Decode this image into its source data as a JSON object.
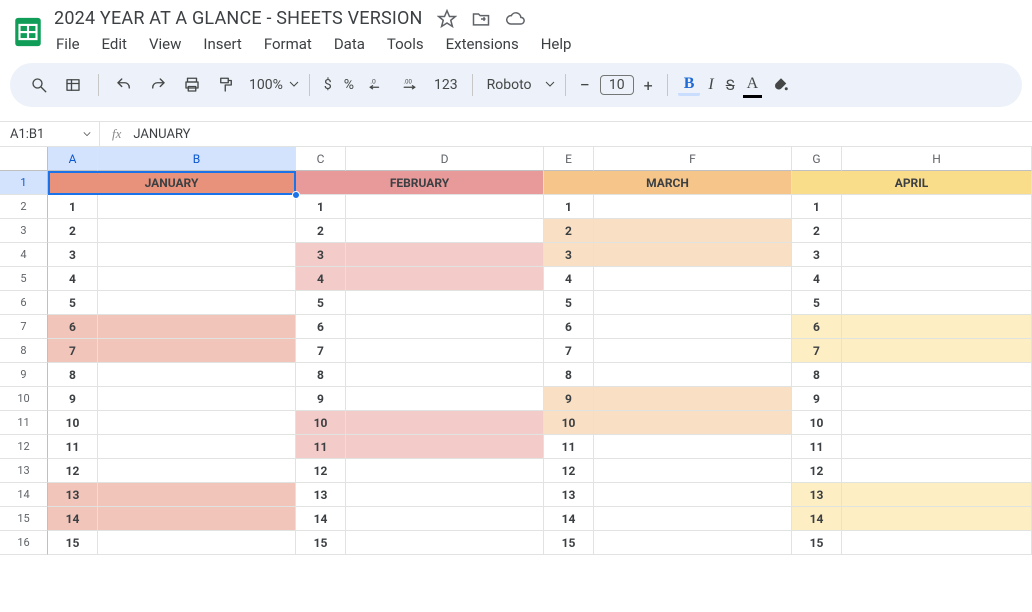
{
  "doc": {
    "title": "2024 YEAR AT A GLANCE - SHEETS VERSION",
    "menus": [
      "File",
      "Edit",
      "View",
      "Insert",
      "Format",
      "Data",
      "Tools",
      "Extensions",
      "Help"
    ]
  },
  "toolbar": {
    "zoom": "100%",
    "currency": "$",
    "percent": "%",
    "dec_less": ".0",
    "dec_more": ".00",
    "numformat": "123",
    "font": "Roboto",
    "minus": "−",
    "fontsize": "10",
    "plus": "+",
    "bold": "B",
    "italic": "I",
    "strike": "S",
    "textcolor": "A"
  },
  "namebox": "A1:B1",
  "formula": "JANUARY",
  "columns": [
    "A",
    "B",
    "C",
    "D",
    "E",
    "F",
    "G",
    "H"
  ],
  "col_selected": [
    "A",
    "B"
  ],
  "rows_visible": 16,
  "row_selected": 1,
  "months": [
    {
      "label": "JANUARY",
      "bg": "#e8927c"
    },
    {
      "label": "FEBRUARY",
      "bg": "#e89a9a"
    },
    {
      "label": "MARCH",
      "bg": "#f5c58a"
    },
    {
      "label": "APRIL",
      "bg": "#fadd8b"
    }
  ],
  "shade": {
    "jan": "#f1c5b9",
    "feb": "#f3cbc9",
    "mar": "#f9e0c4",
    "apr": "#fdeec4"
  },
  "days": {
    "jan_weekend": [
      6,
      7,
      13,
      14
    ],
    "feb_weekend": [
      3,
      4,
      10,
      11
    ],
    "mar_weekend": [
      2,
      3,
      9,
      10
    ],
    "apr_weekend": [
      6,
      7,
      13,
      14
    ]
  }
}
